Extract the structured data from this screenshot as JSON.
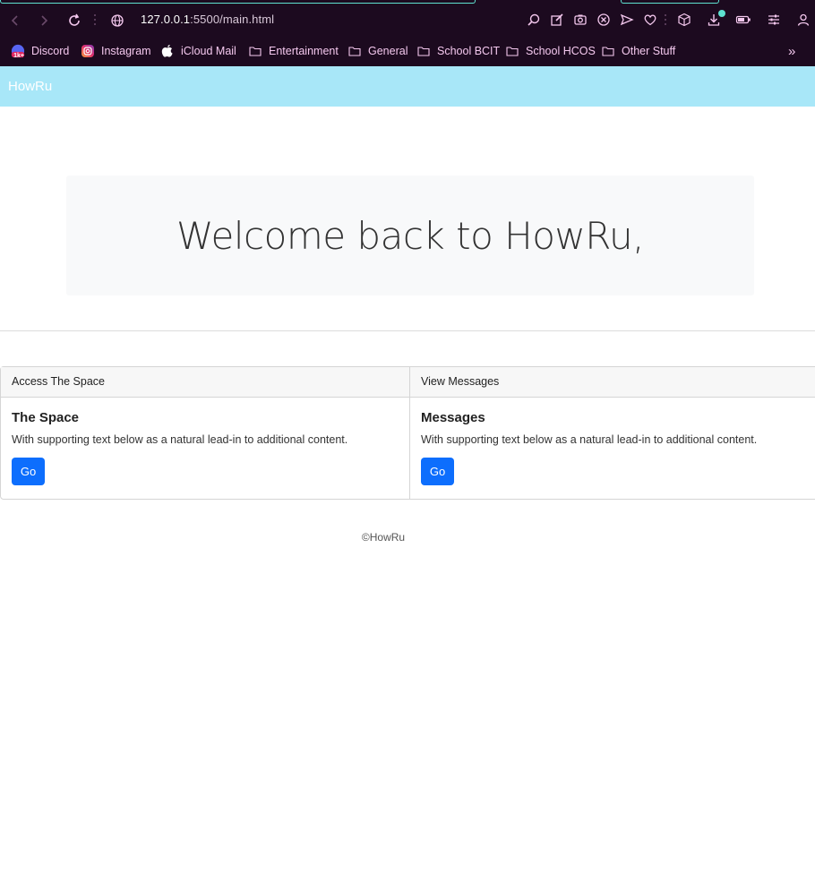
{
  "browser": {
    "url_host": "127.0.0.1",
    "url_rest": ":5500/main.html",
    "bookmarks": [
      {
        "label": "Discord",
        "icon": "discord-icon",
        "badge": "1k+"
      },
      {
        "label": "Instagram",
        "icon": "instagram-icon"
      },
      {
        "label": "iCloud Mail",
        "icon": "apple-icon"
      },
      {
        "label": "Entertainment",
        "icon": "folder-icon"
      },
      {
        "label": "General",
        "icon": "folder-icon"
      },
      {
        "label": "School BCIT",
        "icon": "folder-icon"
      },
      {
        "label": "School HCOS",
        "icon": "folder-icon"
      },
      {
        "label": "Other Stuff",
        "icon": "folder-icon"
      }
    ],
    "more_bookmarks": "»",
    "colors": {
      "chrome_bg": "#1c0a1f",
      "bookmark_text": "#f4c8ee",
      "accent": "#5ee1d0"
    }
  },
  "navbar": {
    "brand": "HowRu",
    "bg": "#a8e7f8"
  },
  "hero": {
    "title": "Welcome back to HowRu,"
  },
  "cards": [
    {
      "header": "Access The Space",
      "title": "The Space",
      "text": "With supporting text below as a natural lead-in to additional content.",
      "button": "Go"
    },
    {
      "header": "View Messages",
      "title": "Messages",
      "text": "With supporting text below as a natural lead-in to additional content.",
      "button": "Go"
    }
  ],
  "footer": {
    "text": "©HowRu"
  },
  "colors": {
    "primary_button": "#0d6efd"
  }
}
